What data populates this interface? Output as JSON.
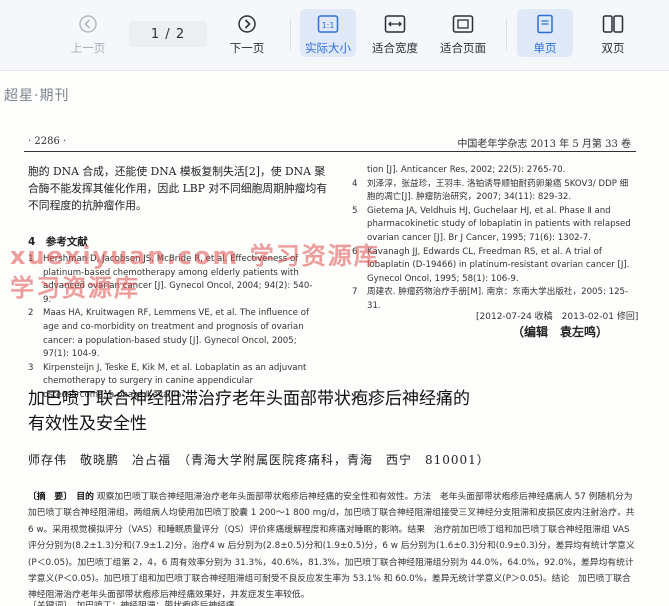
{
  "toolbar": {
    "prev": "上一页",
    "page_indicator": "1 / 2",
    "next": "下一页",
    "actual_size": "实际大小",
    "fit_width": "适合宽度",
    "fit_page": "适合页面",
    "single_page": "单页",
    "two_page": "双页"
  },
  "doc": {
    "brand": "超星·期刊",
    "page_number": "· 2286 ·",
    "journal": "中国老年学杂志 2013 年 5 月第 33 卷",
    "col_left_text": "胞的 DNA 合成，还能使 DNA 模板复制失活[2]，使 DNA 聚合酶不能发挥其催化作用，因此 LBP 对不同细胞周期肿瘤均有不同程度的抗肿瘤作用。",
    "ref_title": "4　参考文献",
    "refs_left": [
      {
        "n": "1",
        "text": "Hershman D, Jacobson JS, McBride R, et al. Effectiveness of platinum-based chemotherapy among elderly patients with advanced ovarian cancer [J]. Gynecol Oncol, 2004; 94(2): 540-9."
      },
      {
        "n": "2",
        "text": "Maas HA, Kruitwagen RF, Lemmens VE, et al. The influence of age and co-morbidity on treatment and prognosis of ovarian cancer: a population-based study [J]. Gynecol Oncol, 2005; 97(1): 104-9."
      },
      {
        "n": "3",
        "text": "Kirpensteijn J, Teske E, Kik M, et al. Lobaplatin as an adjuvant chemotherapy to surgery in canine appendicular osteosarcoma: a phase Ⅱ evalua-"
      }
    ],
    "refs_right": [
      {
        "n": "",
        "text": "tion [J]. Anticancer Res, 2002; 22(5): 2765-70."
      },
      {
        "n": "4",
        "text": "刘泽淳，张益珍，王羽丰. 洛铂诱导顺铂耐药卵巢癌 SKOV3/ DDP 细胞的凋亡[J]. 肿瘤防治研究，2007; 34(11): 829-32."
      },
      {
        "n": "5",
        "text": "Gietema JA, Veldhuis HJ, Guchelaar HJ, et al. Phase Ⅱ and pharmacokinetic study of lobaplatin in patients with relapsed ovarian cancer [J]. Br J Cancer, 1995; 71(6): 1302-7."
      },
      {
        "n": "6",
        "text": "Kavanagh JJ, Edwards CL, Freedman RS, et al. A trial of lobaplatin (D-19466) in platinum-resistant ovarian cancer [J]. Gynecol Oncol, 1995; 58(1): 106-9."
      },
      {
        "n": "7",
        "text": "周建农. 肿瘤药物治疗手册[M]. 南京：东南大学出版社，2005: 125-31."
      }
    ],
    "dates": "[2012-07-24 收稿　2013-02-01 修回]",
    "editor": "（编辑　袁左鸣）",
    "title_line1": "加巴喷丁联合神经阻滞治疗老年头面部带状疱疹后神经痛的",
    "title_line2": "有效性及安全性",
    "authors": "师存伟　敬晓鹏　冶占福　（青海大学附属医院疼痛科，青海　西宁　810001）",
    "abstract_label": "〔摘　要〕　目的",
    "abstract_text": "观察加巴喷丁联合神经阻滞治疗老年头面部带状疱疹后神经痛的安全性和有效性。方法　老年头面部带状疱疹后神经痛病人 57 例随机分为加巴喷丁联合神经阻滞组，两组病人均使用加巴喷丁胶囊 1 200～1 800 mg/d，加巴喷丁联合神经阻滞组接受三叉神经分支阻滞和皮损区皮内注射治疗，共6 w。采用视觉模拟评分（VAS）和睡眠质量评分（QS）评价疼痛缓解程度和疼痛对睡眠的影响。结果　治疗前加巴喷丁组和加巴喷丁联合神经阻滞组 VAS 评分分别为(8.2±1.3)分和(7.9±1.2)分，治疗4 w 后分别为(2.8±0.5)分和(1.9±0.5)分，6 w 后分别为(1.6±0.3)分和(0.9±0.3)分，差异均有统计学意义(P＜0.05)。加巴喷丁组第 2，4，6 周有效率分别为 31.3%，40.6%，81.3%，加巴喷丁联合神经阻滞组分别为 44.0%，64.0%，92.0%，差异均有统计学意义(P＜0.05)。加巴喷丁组和加巴喷丁联合神经阻滞组可耐受不良反应发生率为 53.1% 和 60.0%，差异无统计学意义(P＞0.05)。结论　加巴喷丁联合神经阻滞治疗老年头面部带状疱疹后神经痛效果好，并发症发生率较低。",
    "keywords": "〔关键词〕　加巴喷丁；神经阻滞；带状疱疹后神经痛",
    "watermark_line1": "xuexiyuan.com 学习资源库",
    "watermark_line2": "学习资源库"
  }
}
